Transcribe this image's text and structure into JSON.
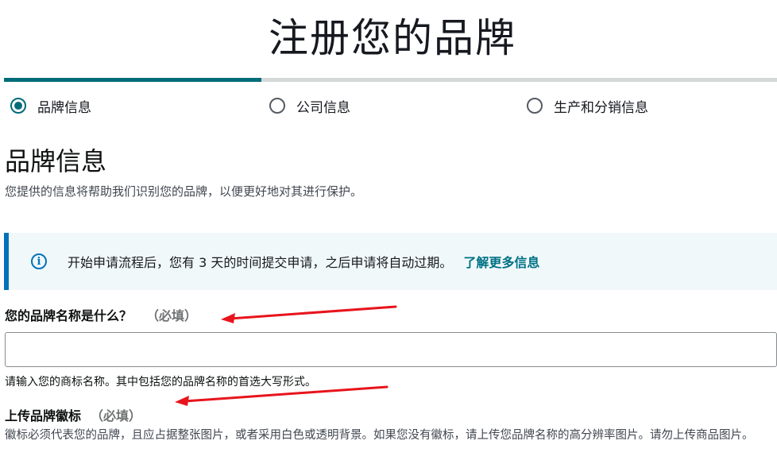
{
  "page": {
    "title": "注册您的品牌"
  },
  "progress": {
    "fraction": 0.333
  },
  "steps": [
    {
      "label": "品牌信息",
      "selected": true
    },
    {
      "label": "公司信息",
      "selected": false
    },
    {
      "label": "生产和分销信息",
      "selected": false
    }
  ],
  "section": {
    "title": "品牌信息",
    "description": "您提供的信息将帮助我们识别您的品牌，以便更好地对其进行保护。"
  },
  "info_box": {
    "icon": "info-icon",
    "text": "开始申请流程后，您有 3 天的时间提交申请，之后申请将自动过期。",
    "link": "了解更多信息"
  },
  "brand_name": {
    "label": "您的品牌名称是什么？",
    "required": "（必填）",
    "value": "",
    "hint": "请输入您的商标名称。其中包括您的品牌名称的首选大写形式。"
  },
  "brand_logo": {
    "label": "上传品牌徽标",
    "required": "（必填）",
    "description": "徽标必须代表您的品牌，且应占据整张图片，或者采用白色或透明背景。如果您没有徽标，请上传您品牌名称的高分辨率图片。请勿上传商品图片。"
  },
  "colors": {
    "accent": "#006c7a",
    "info_border": "#0073bb",
    "annotation_arrow": "#e8141c"
  }
}
